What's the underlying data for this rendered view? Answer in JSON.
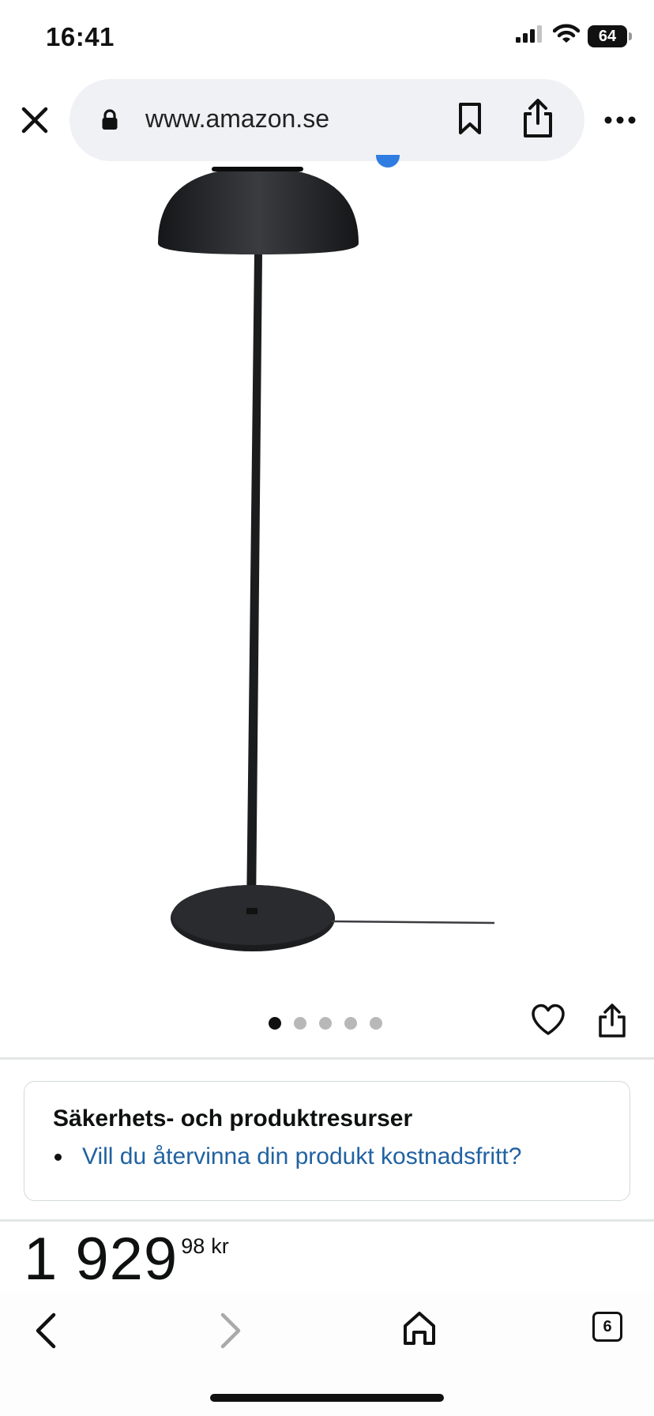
{
  "status_bar": {
    "time": "16:41",
    "battery_level": "64",
    "icons": [
      "signal-icon",
      "wifi-icon",
      "battery-icon"
    ]
  },
  "browser": {
    "url": "www.amazon.se",
    "icons": [
      "close-icon",
      "lock-icon",
      "bookmark-icon",
      "share-icon",
      "more-icon"
    ]
  },
  "product": {
    "image_subject": "floor-lamp",
    "image_count": 5,
    "active_image_index": 0
  },
  "safety": {
    "title": "Säkerhets- och produktresurser",
    "items": [
      {
        "label": "Vill du återvinna din produkt kostnadsfritt?"
      }
    ]
  },
  "price": {
    "whole": "1 929",
    "fraction": "98",
    "currency": "kr"
  },
  "toolbar": {
    "tabs_count": "6",
    "icons": [
      "back-icon",
      "forward-icon",
      "home-icon",
      "tabs-icon"
    ]
  },
  "colors": {
    "link": "#2162a1",
    "pill_background": "#f0f1f4",
    "accent_blue": "#2f7de1"
  }
}
